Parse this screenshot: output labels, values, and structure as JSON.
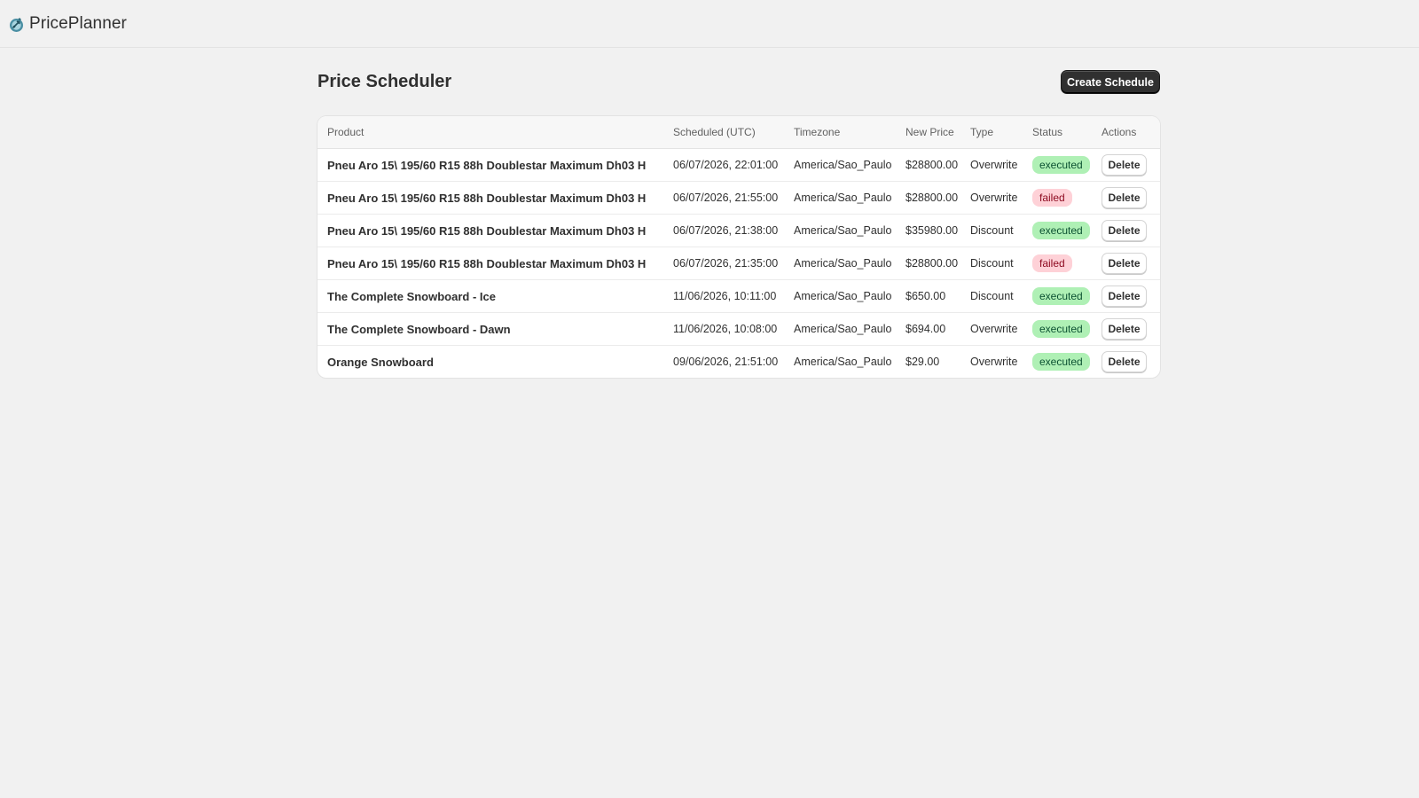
{
  "app": {
    "name": "PricePlanner",
    "logo_icon": "rocket-logo-icon"
  },
  "page": {
    "title": "Price Scheduler",
    "create_label": "Create Schedule"
  },
  "table": {
    "headers": [
      "Product",
      "Scheduled (UTC)",
      "Timezone",
      "New Price",
      "Type",
      "Status",
      "Actions"
    ],
    "rows": [
      {
        "product": "Pneu Aro 15\\ 195/60 R15 88h Doublestar Maximum Dh03 H",
        "scheduled": "06/07/2026, 22:01:00",
        "timezone": "America/Sao_Paulo",
        "price": "$28800.00",
        "type": "Overwrite",
        "status": "executed",
        "action": "Delete"
      },
      {
        "product": "Pneu Aro 15\\ 195/60 R15 88h Doublestar Maximum Dh03 H",
        "scheduled": "06/07/2026, 21:55:00",
        "timezone": "America/Sao_Paulo",
        "price": "$28800.00",
        "type": "Overwrite",
        "status": "failed",
        "action": "Delete"
      },
      {
        "product": "Pneu Aro 15\\ 195/60 R15 88h Doublestar Maximum Dh03 H",
        "scheduled": "06/07/2026, 21:38:00",
        "timezone": "America/Sao_Paulo",
        "price": "$35980.00",
        "type": "Discount",
        "status": "executed",
        "action": "Delete"
      },
      {
        "product": "Pneu Aro 15\\ 195/60 R15 88h Doublestar Maximum Dh03 H",
        "scheduled": "06/07/2026, 21:35:00",
        "timezone": "America/Sao_Paulo",
        "price": "$28800.00",
        "type": "Discount",
        "status": "failed",
        "action": "Delete"
      },
      {
        "product": "The Complete Snowboard - Ice",
        "scheduled": "11/06/2026, 10:11:00",
        "timezone": "America/Sao_Paulo",
        "price": "$650.00",
        "type": "Discount",
        "status": "executed",
        "action": "Delete"
      },
      {
        "product": "The Complete Snowboard - Dawn",
        "scheduled": "11/06/2026, 10:08:00",
        "timezone": "America/Sao_Paulo",
        "price": "$694.00",
        "type": "Overwrite",
        "status": "executed",
        "action": "Delete"
      },
      {
        "product": "Orange Snowboard",
        "scheduled": "09/06/2026, 21:51:00",
        "timezone": "America/Sao_Paulo",
        "price": "$29.00",
        "type": "Overwrite",
        "status": "executed",
        "action": "Delete"
      }
    ]
  },
  "colors": {
    "executed_bg": "#aff0b5",
    "failed_bg": "#fed1d7",
    "primary_button": "#303030"
  }
}
